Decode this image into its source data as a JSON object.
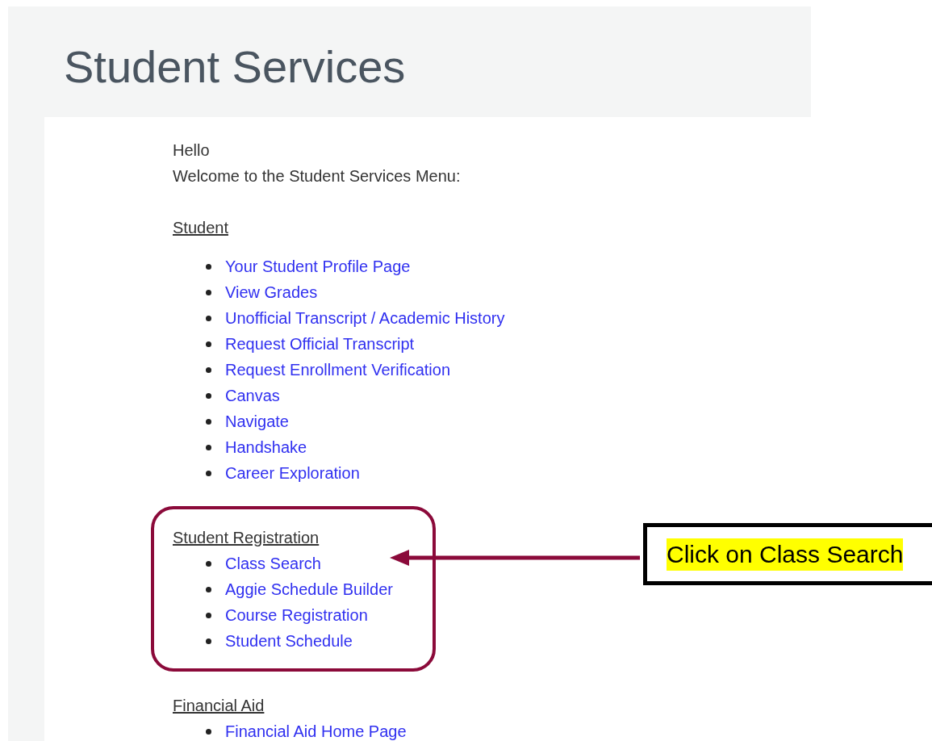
{
  "page_title": "Student Services",
  "greeting": "Hello",
  "welcome": "Welcome to the Student Services Menu:",
  "sections": [
    {
      "heading": "Student",
      "links": [
        "Your Student Profile Page",
        "View Grades",
        "Unofficial Transcript / Academic History",
        "Request Official Transcript",
        "Request Enrollment Verification",
        "Canvas",
        "Navigate",
        "Handshake",
        "Career Exploration"
      ]
    },
    {
      "heading": "Student Registration",
      "links": [
        "Class Search",
        "Aggie Schedule Builder",
        "Course Registration",
        "Student Schedule"
      ]
    },
    {
      "heading": "Financial Aid",
      "links": [
        "Financial Aid Home Page"
      ]
    }
  ],
  "callout": {
    "text": "Click on Class Search"
  }
}
